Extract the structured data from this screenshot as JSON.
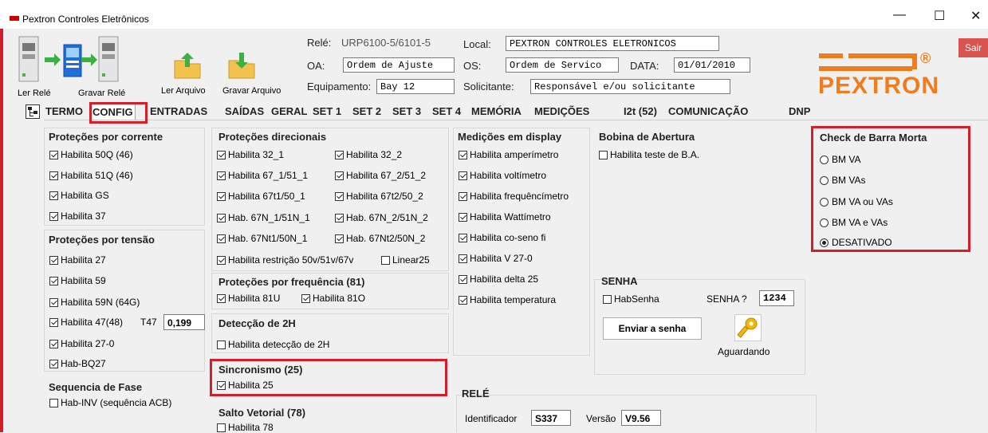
{
  "window": {
    "title": "Pextron Controles Eletrônicos",
    "minimize": "—",
    "maximize": "☐",
    "close": "✕"
  },
  "toolbar": {
    "ler_rele": "Ler Relé",
    "gravar_rele": "Gravar Relé",
    "ler_arquivo": "Ler Arquivo",
    "gravar_arquivo": "Gravar Arquivo",
    "sair": "Sair"
  },
  "fields": {
    "rele_label": "Relé:",
    "rele_value": "URP6100-5/6101-5",
    "oa_label": "OA:",
    "oa_value": "Ordem de Ajuste",
    "equipamento_label": "Equipamento:",
    "equipamento_value": "Bay 12",
    "local_label": "Local:",
    "local_value": "PEXTRON CONTROLES ELETRONICOS",
    "os_label": "OS:",
    "os_value": "Ordem de Servico",
    "data_label": "DATA:",
    "data_value": "01/01/2010",
    "solicitante_label": "Solicitante:",
    "solicitante_value": "Responsável e/ou solicitante"
  },
  "logo": {
    "text": "PEXTRON",
    "reg": "®",
    "color": "#f07c1e"
  },
  "tabs": [
    "TERMO",
    "CONFIG",
    "ENTRADAS",
    "SAÍDAS",
    "GERAL",
    "SET 1",
    "SET 2",
    "SET 3",
    "SET 4",
    "MEMÓRIA",
    "MEDIÇÕES",
    "I2t (52)",
    "COMUNICAÇÃO",
    "DNP"
  ],
  "active_tab": "CONFIG",
  "corrente": {
    "title": "Proteções por corrente",
    "items": [
      {
        "label": "Habilita 50Q (46)",
        "checked": true
      },
      {
        "label": "Habilita 51Q (46)",
        "checked": true
      },
      {
        "label": "Habilita GS",
        "checked": true
      },
      {
        "label": "Habilita 37",
        "checked": true
      }
    ]
  },
  "tensao": {
    "title": "Proteções por tensão",
    "items": [
      {
        "label": "Habilita 27",
        "checked": true
      },
      {
        "label": "Habilita 59",
        "checked": true
      },
      {
        "label": "Habilita 59N (64G)",
        "checked": true
      },
      {
        "label": "Habilita 47(48)",
        "checked": true
      },
      {
        "label": "Habilita 27-0",
        "checked": true
      },
      {
        "label": "Hab-BQ27",
        "checked": true
      }
    ],
    "t47_label": "T47",
    "t47_value": "0,199"
  },
  "fase": {
    "title": "Sequencia de Fase",
    "items": [
      {
        "label": "Hab-INV (sequência ACB)",
        "checked": false
      }
    ]
  },
  "direcionais": {
    "title": "Proteções direcionais",
    "items": [
      {
        "label": "Habilita 32_1",
        "checked": true
      },
      {
        "label": "Habilita 32_2",
        "checked": true
      },
      {
        "label": "Habilita 67_1/51_1",
        "checked": true
      },
      {
        "label": "Habilita 67_2/51_2",
        "checked": true
      },
      {
        "label": "Habilita 67t1/50_1",
        "checked": true
      },
      {
        "label": "Habilita 67t2/50_2",
        "checked": true
      },
      {
        "label": "Hab. 67N_1/51N_1",
        "checked": true
      },
      {
        "label": "Hab. 67N_2/51N_2",
        "checked": true
      },
      {
        "label": "Hab. 67Nt1/50N_1",
        "checked": true
      },
      {
        "label": "Hab. 67Nt2/50N_2",
        "checked": true
      },
      {
        "label": "Habilita restrição 50v/51v/67v",
        "checked": true
      },
      {
        "label": "Linear25",
        "checked": false
      }
    ]
  },
  "frequencia": {
    "title": "Proteções por frequência (81)",
    "items": [
      {
        "label": "Habilita 81U",
        "checked": true
      },
      {
        "label": "Habilita 81O",
        "checked": true
      }
    ]
  },
  "deteccao": {
    "title": "Detecção de 2H",
    "items": [
      {
        "label": "Habilita detecção de 2H",
        "checked": false
      }
    ]
  },
  "sincronismo": {
    "title": "Sincronismo (25)",
    "items": [
      {
        "label": "Habilita 25",
        "checked": true
      }
    ]
  },
  "salto": {
    "title": "Salto Vetorial (78)",
    "items": [
      {
        "label": "Habilita 78",
        "checked": false
      }
    ]
  },
  "medicoes": {
    "title": "Medições em display",
    "items": [
      {
        "label": "Habilita amperímetro",
        "checked": true
      },
      {
        "label": "Habilita voltímetro",
        "checked": true
      },
      {
        "label": "Habilita frequêncímetro",
        "checked": true
      },
      {
        "label": "Habilita Wattímetro",
        "checked": true
      },
      {
        "label": "Habilita co-seno fi",
        "checked": true
      },
      {
        "label": "Habilita V 27-0",
        "checked": true
      },
      {
        "label": "Habilita delta 25",
        "checked": true
      },
      {
        "label": "Habilita temperatura",
        "checked": true
      }
    ]
  },
  "bobina": {
    "title": "Bobina de Abertura",
    "items": [
      {
        "label": "Habilita teste de B.A.",
        "checked": false
      }
    ]
  },
  "senha": {
    "title": "SENHA",
    "hab_label": "HabSenha",
    "hab_checked": false,
    "senha_label": "SENHA ?",
    "senha_value": "1234",
    "enviar": "Enviar a senha",
    "status": "Aguardando"
  },
  "rele": {
    "title": "RELÉ",
    "id_label": "Identificador",
    "id_value": "S337",
    "versao_label": "Versão",
    "versao_value": "V9.56"
  },
  "barra_morta": {
    "title": "Check de Barra Morta",
    "options": [
      {
        "label": "BM VA",
        "selected": false
      },
      {
        "label": "BM VAs",
        "selected": false
      },
      {
        "label": "BM VA ou VAs",
        "selected": false
      },
      {
        "label": "BM VA e VAs",
        "selected": false
      },
      {
        "label": "DESATIVADO",
        "selected": true
      }
    ]
  }
}
